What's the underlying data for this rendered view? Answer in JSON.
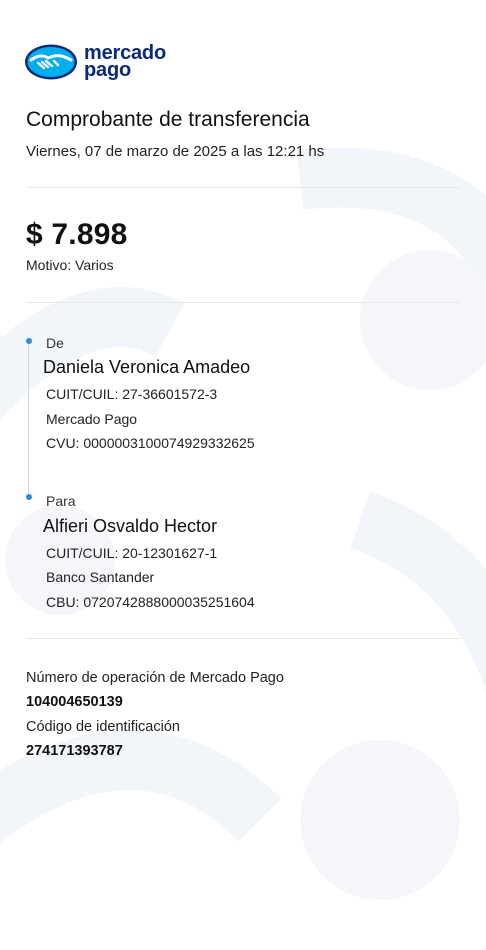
{
  "brand": {
    "line1": "mercado",
    "line2": "pago",
    "logo_color": "#0a2a7a",
    "logo_fill": "#00aeef"
  },
  "receipt": {
    "title": "Comprobante de transferencia",
    "date": "Viernes, 07 de marzo de 2025 a las 12:21 hs",
    "amount": "$ 7.898",
    "reason": "Motivo: Varios"
  },
  "sender": {
    "label": "De",
    "name": "Daniela Veronica Amadeo",
    "tax_id": "CUIT/CUIL: 27-36601572-3",
    "bank": "Mercado Pago",
    "account": "CVU: 0000003100074929332625"
  },
  "recipient": {
    "label": "Para",
    "name": "Alfieri Osvaldo Hector",
    "tax_id": "CUIT/CUIL: 20-12301627-1",
    "bank": "Banco Santander",
    "account": "CBU: 0720742888000035251604"
  },
  "operation": {
    "number_label": "Número de operación de Mercado Pago",
    "number_value": "104004650139",
    "code_label": "Código de identificación",
    "code_value": "274171393787"
  },
  "colors": {
    "accent_dot": "#2b8bd6",
    "watermark": "#f3f6fa"
  }
}
